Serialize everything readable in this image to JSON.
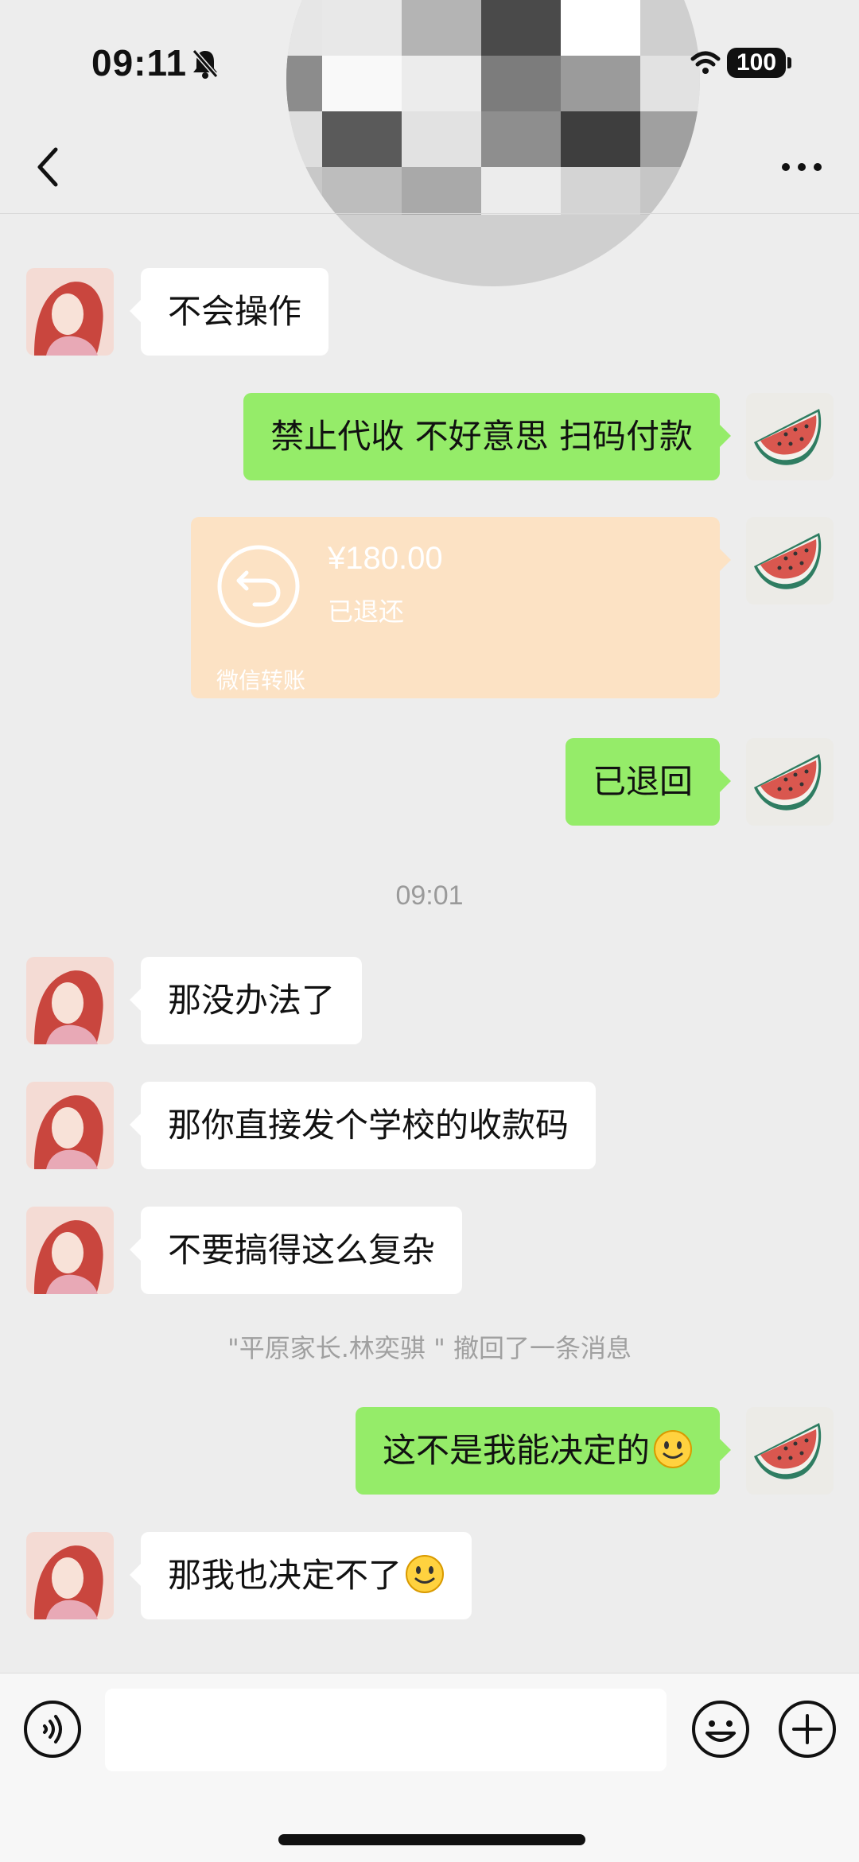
{
  "status_bar": {
    "time": "09:11",
    "battery": "100",
    "icons": [
      "bell-off-icon",
      "wifi-icon",
      "battery-icon"
    ]
  },
  "header": {
    "contact_name_redacted": true,
    "icons": [
      "back-icon",
      "more-icon"
    ]
  },
  "colors": {
    "background": "#ededed",
    "outgoing_bubble": "#95ec69",
    "incoming_bubble": "#ffffff",
    "transfer_card": "#fce2c4",
    "meta_text": "#9a9a9a"
  },
  "messages": [
    {
      "side": "left",
      "text": "不会操作"
    },
    {
      "side": "right",
      "text": "禁止代收  不好意思  扫码付款"
    },
    {
      "side": "right",
      "type": "transfer",
      "amount": "¥180.00",
      "status": "已退还",
      "footer": "微信转账"
    },
    {
      "side": "right",
      "text": "已退回"
    },
    {
      "side": "left",
      "text": "那没办法了"
    },
    {
      "side": "left",
      "text": "那你直接发个学校的收款码"
    },
    {
      "side": "left",
      "text": "不要搞得这么复杂"
    },
    {
      "side": "right",
      "text": "这不是我能决定的",
      "emoji": "smile-emoji"
    },
    {
      "side": "left",
      "text": "那我也决定不了",
      "emoji": "smile-emoji"
    }
  ],
  "timestamp": "09:01",
  "system_note": "\"平原家长.林奕骐 \" 撤回了一条消息",
  "input_bar": {
    "value": "",
    "icons": [
      "voice-icon",
      "emoji-icon",
      "plus-icon"
    ]
  }
}
